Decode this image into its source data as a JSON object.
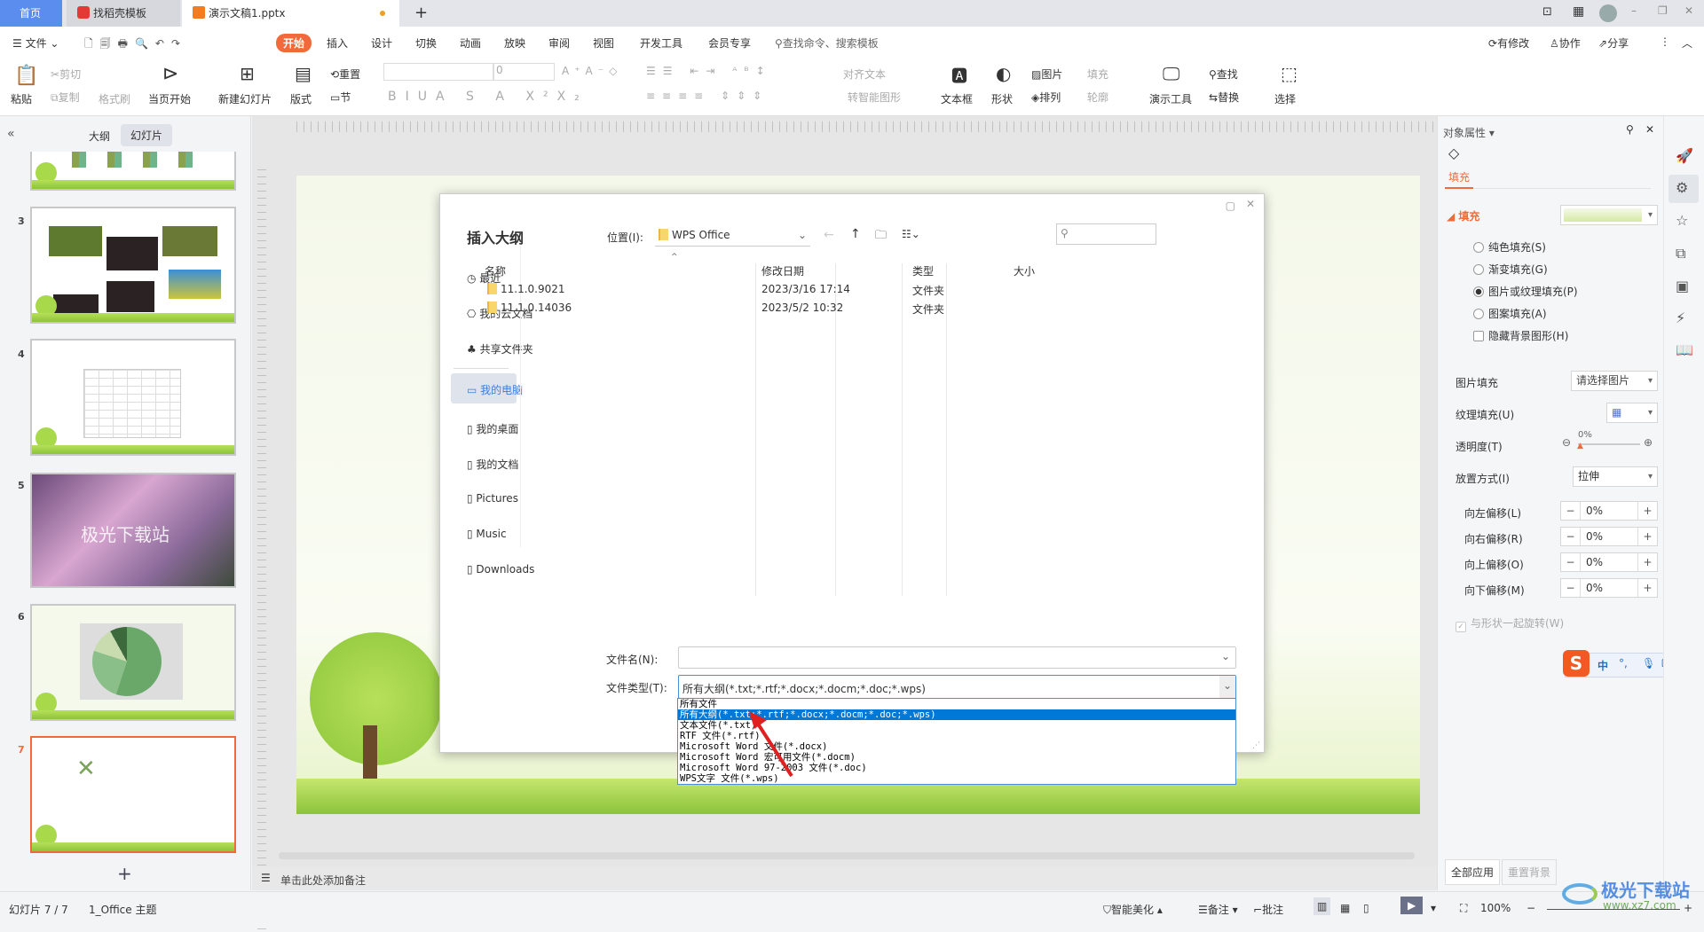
{
  "tabs": [
    {
      "label": "首页"
    },
    {
      "label": "找稻壳模板"
    },
    {
      "label": "演示文稿1.pptx"
    }
  ],
  "menu": {
    "file": "文件",
    "items": [
      "开始",
      "插入",
      "设计",
      "切换",
      "动画",
      "放映",
      "审阅",
      "视图",
      "开发工具",
      "会员专享"
    ],
    "search": "查找命令、搜索模板",
    "modified": "有修改",
    "collab": "协作",
    "share": "分享"
  },
  "ribbon": {
    "paste": "粘贴",
    "cut": "剪切",
    "copy": "复制",
    "format_painter": "格式刷",
    "play_from_current": "当页开始",
    "new_slide": "新建幻灯片",
    "layout": "版式",
    "reset": "重置",
    "section": "节",
    "font_size": "0",
    "align_text": "对齐文本",
    "smart_art": "转智能图形",
    "textbox": "文本框",
    "shape": "形状",
    "picture": "图片",
    "arrange": "排列",
    "fill": "填充",
    "outline": "轮廓",
    "present_tools": "演示工具",
    "find": "查找",
    "replace": "替换",
    "select": "选择"
  },
  "left_panel": {
    "tab_outline": "大纲",
    "tab_slides": "幻灯片",
    "slide_numbers": [
      "3",
      "4",
      "5",
      "6",
      "7"
    ],
    "slide5_text": "极光下载站"
  },
  "dialog": {
    "title": "插入大纲",
    "location_label": "位置(I):",
    "location_value": "WPS Office",
    "nav": [
      "最近",
      "我的云文档",
      "共享文件夹",
      "我的电脑",
      "我的桌面",
      "我的文档",
      "Pictures",
      "Music",
      "Downloads"
    ],
    "columns": [
      "名称",
      "修改日期",
      "类型",
      "大小"
    ],
    "files": [
      {
        "name": "11.1.0.9021",
        "date": "2023/3/16 17:14",
        "type": "文件夹"
      },
      {
        "name": "11.1.0.14036",
        "date": "2023/5/2 10:32",
        "type": "文件夹"
      }
    ],
    "filename_label": "文件名(N):",
    "filename_value": "",
    "filetype_label": "文件类型(T):",
    "filetype_value": "所有大纲(*.txt;*.rtf;*.docx;*.docm;*.doc;*.wps)",
    "filetype_options": [
      "所有文件",
      "所有大纲(*.txt;*.rtf;*.docx;*.docm;*.doc;*.wps)",
      "文本文件(*.txt)",
      "RTF 文件(*.rtf)",
      "Microsoft Word 文件(*.docx)",
      "Microsoft Word 宏可用文件(*.docm)",
      "Microsoft Word 97-2003 文件(*.doc)",
      "WPS文字 文件(*.wps)"
    ]
  },
  "notes_placeholder": "单击此处添加备注",
  "right_panel": {
    "title": "对象属性",
    "tab_fill": "填充",
    "section_fill": "填充",
    "options": [
      {
        "label": "纯色填充(S)",
        "checked": false
      },
      {
        "label": "渐变填充(G)",
        "checked": false
      },
      {
        "label": "图片或纹理填充(P)",
        "checked": true
      },
      {
        "label": "图案填充(A)",
        "checked": false
      }
    ],
    "hide_bg": "隐藏背景图形(H)",
    "picture_fill_label": "图片填充",
    "picture_fill_value": "请选择图片",
    "texture_label": "纹理填充(U)",
    "transparency_label": "透明度(T)",
    "transparency_value": "0%",
    "placement_label": "放置方式(I)",
    "placement_value": "拉伸",
    "offsets": [
      {
        "label": "向左偏移(L)",
        "value": "0%"
      },
      {
        "label": "向右偏移(R)",
        "value": "0%"
      },
      {
        "label": "向上偏移(O)",
        "value": "0%"
      },
      {
        "label": "向下偏移(M)",
        "value": "0%"
      }
    ],
    "rotate_with_shape": "与形状一起旋转(W)",
    "apply_all": "全部应用",
    "reset_bg": "重置背景"
  },
  "ime": {
    "mode": "中",
    "punct": "°,"
  },
  "status": {
    "slide_count": "幻灯片 7 / 7",
    "theme": "1_Office 主题",
    "beautify": "智能美化",
    "notes": "备注",
    "comments": "批注",
    "zoom": "100%"
  },
  "watermark": {
    "text": "极光下载站",
    "url": "www.xz7.com"
  },
  "colors": {
    "accent": "#f26a3c",
    "home_tab": "#5b8def",
    "selection": "#0078d7"
  }
}
